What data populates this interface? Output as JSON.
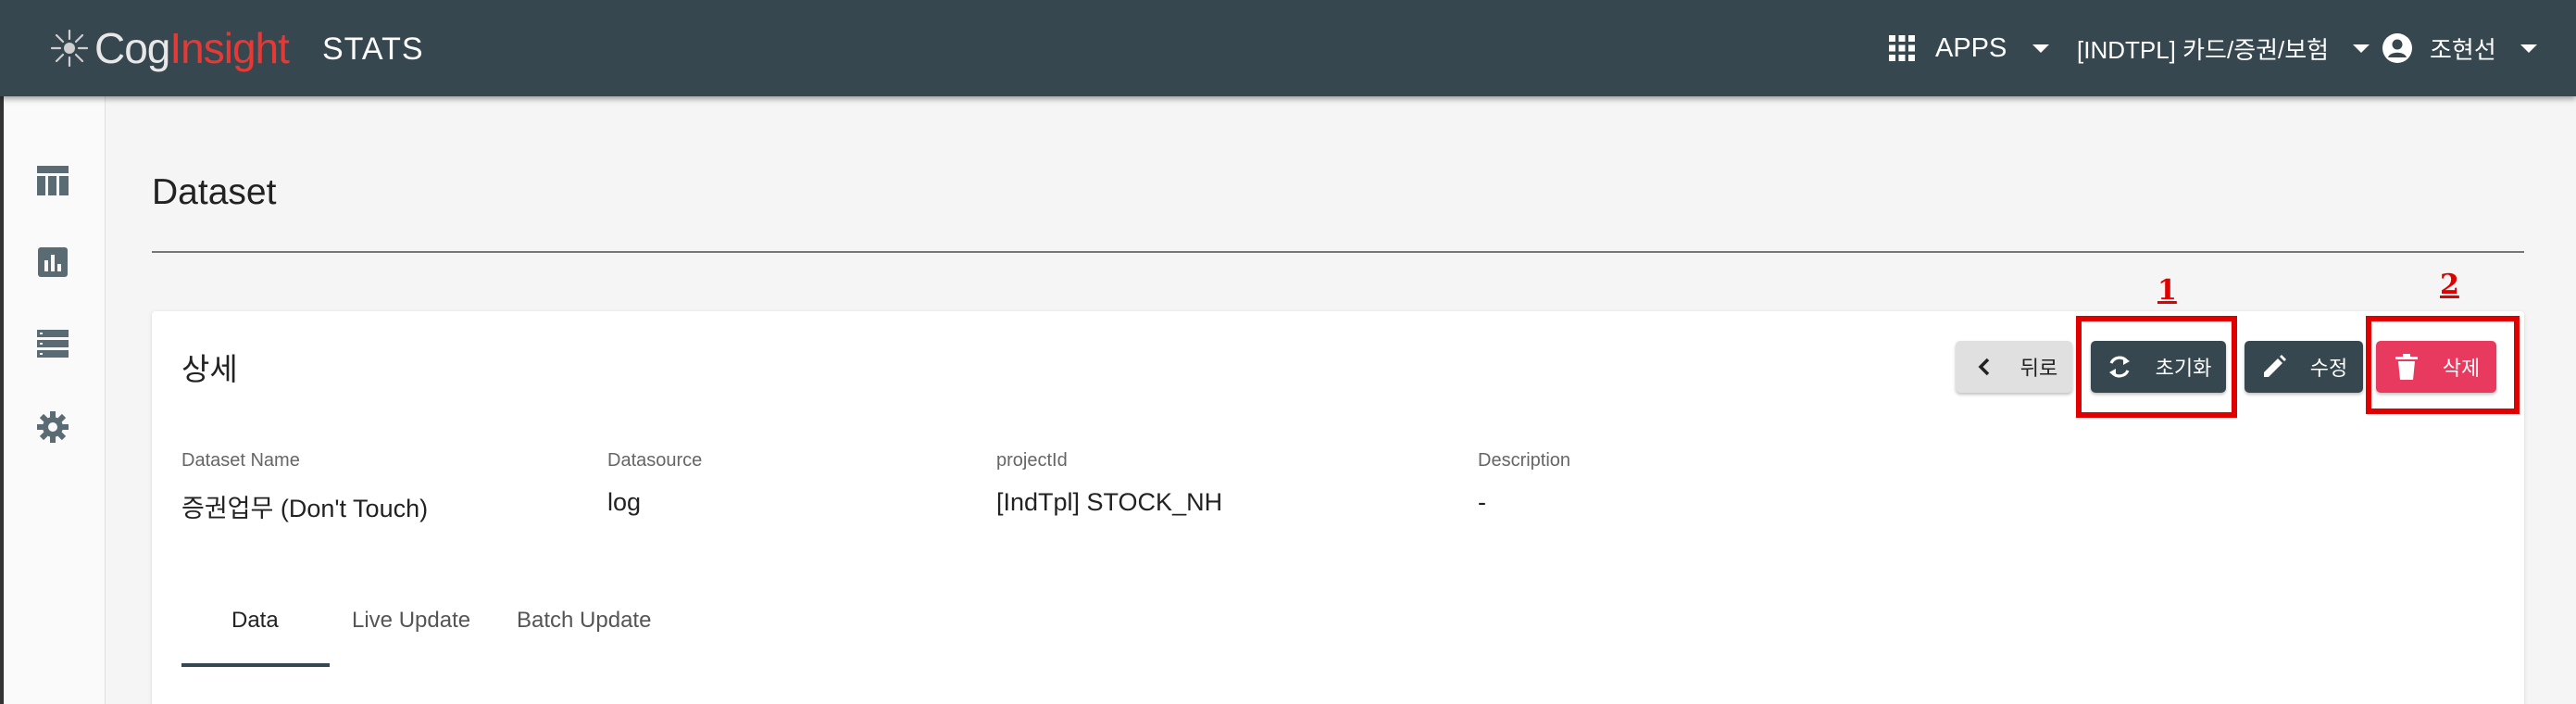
{
  "header": {
    "logo_part1": "Cog",
    "logo_part2": "Insight",
    "app_name": "STATS",
    "apps_label": "APPS",
    "project_label": "[INDTPL] 카드/증권/보험",
    "user_label": "조현선"
  },
  "sidebar": {
    "items": [
      {
        "icon": "table-icon"
      },
      {
        "icon": "chart-icon"
      },
      {
        "icon": "list-icon"
      },
      {
        "icon": "gear-icon"
      }
    ]
  },
  "page": {
    "title": "Dataset"
  },
  "card": {
    "title": "상세",
    "buttons": {
      "back": "뒤로",
      "reset": "초기화",
      "edit": "수정",
      "delete": "삭제"
    },
    "annotations": {
      "marker1": "1",
      "marker2": "2"
    },
    "fields": [
      {
        "label": "Dataset Name",
        "value": "증권업무 (Don't Touch)"
      },
      {
        "label": "Datasource",
        "value": "log"
      },
      {
        "label": "projectId",
        "value": "[IndTpl] STOCK_NH"
      },
      {
        "label": "Description",
        "value": "-"
      }
    ],
    "tabs": [
      {
        "label": "Data"
      },
      {
        "label": "Live Update"
      },
      {
        "label": "Batch Update"
      }
    ]
  },
  "colors": {
    "header_bg": "#37474f",
    "accent_red": "#e53935",
    "delete_button": "#e83a5f",
    "highlight_box": "#e00000"
  }
}
